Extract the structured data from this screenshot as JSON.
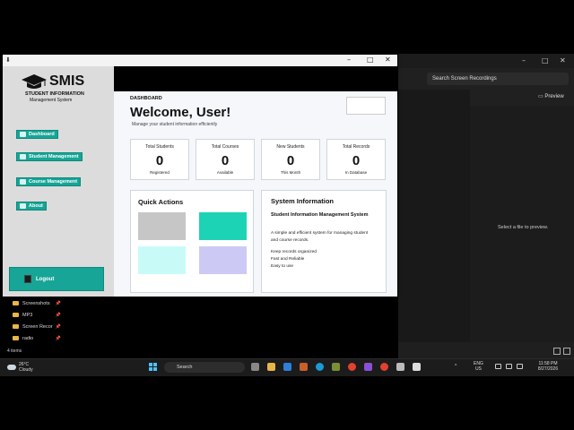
{
  "app": {
    "logo": "SMIS",
    "logo_sub1": "STUDENT INFORMATION",
    "logo_sub2": "Management System",
    "sidebar": [
      {
        "label": "Dashboard"
      },
      {
        "label": "Student Management"
      },
      {
        "label": "Course Management"
      },
      {
        "label": "About"
      }
    ],
    "logout": "Logout"
  },
  "main": {
    "section": "DASHBOARD",
    "welcome": "Welcome, User!",
    "subtitle": "Manage your student information efficiently",
    "stats": [
      {
        "label": "Total Students",
        "value": "0",
        "sub": "Registered"
      },
      {
        "label": "Total Courses",
        "value": "0",
        "sub": "Available"
      },
      {
        "label": "New Students",
        "value": "0",
        "sub": "This Month"
      },
      {
        "label": "Total Records",
        "value": "0",
        "sub": "In Database"
      }
    ],
    "quick_actions": {
      "title": "Quick Actions",
      "tiles": [
        "#c6c6c6",
        "#1dd3b5",
        "#c8fbf7",
        "#cccaf4"
      ]
    },
    "system_info": {
      "title": "System Information",
      "subtitle": "Student Information Management System",
      "desc1": "A simple and efficient system for managing student",
      "desc2": "and course records.",
      "bullet1": "Keep records organized",
      "bullet2": "Fast and Reliable",
      "bullet3": "Easy to use"
    }
  },
  "explorer": {
    "search": "Search Screen Recordings",
    "preview": "Preview",
    "select_msg": "Select a file to preview.",
    "nav": [
      {
        "label": "Screenshots"
      },
      {
        "label": "MP3"
      },
      {
        "label": "Screen Recor"
      },
      {
        "label": "radio"
      }
    ],
    "items_count": "4 items"
  },
  "taskbar": {
    "temp": "26°C",
    "condition": "Cloudy",
    "search": "Search",
    "lang1": "ENG",
    "lang2": "US",
    "time": "11:58 PM",
    "date": "8/27/2026"
  }
}
